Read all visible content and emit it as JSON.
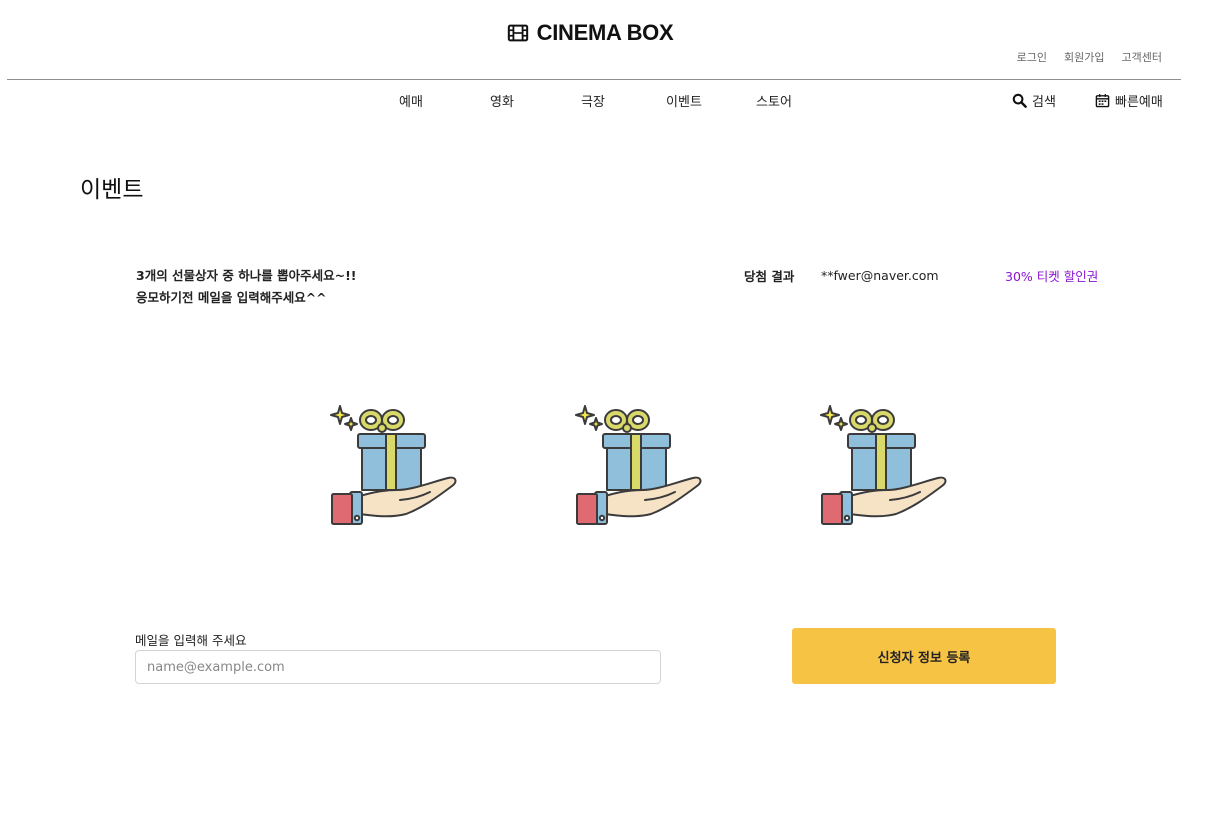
{
  "header": {
    "brand_name": "CINEMA BOX",
    "brand_icon": "film-icon",
    "top_links": [
      "로그인",
      "회원가입",
      "고객센터"
    ]
  },
  "nav": {
    "items": [
      "예매",
      "영화",
      "극장",
      "이벤트",
      "스토어"
    ],
    "search_label": "검색",
    "search_icon": "search-icon",
    "quick_booking_label": "빠른예매",
    "quick_booking_icon": "calendar-icon"
  },
  "page": {
    "title": "이벤트"
  },
  "event": {
    "instruction_line1": "3개의 선물상자 중 하나를 뽑아주세요~!!",
    "instruction_line2": "응모하기전 메일을 입력해주세요^^",
    "result_label": "당첨 결과",
    "result_email": "**fwer@naver.com",
    "result_prize": "30% 티켓 할인권",
    "gift_icon": "gift-in-hand-icon",
    "gift_count": 3
  },
  "form": {
    "email_label": "메일을 입력해 주세요",
    "email_placeholder": "name@example.com",
    "email_value": "",
    "submit_label": "신청자 정보 등록"
  },
  "colors": {
    "accent": "#f6c344",
    "prize_text": "#8a14d1",
    "gift_box": "#8fbfdb",
    "gift_ribbon": "#d9d96a",
    "sleeve": "#e06a72",
    "skin": "#f6e3c6"
  }
}
